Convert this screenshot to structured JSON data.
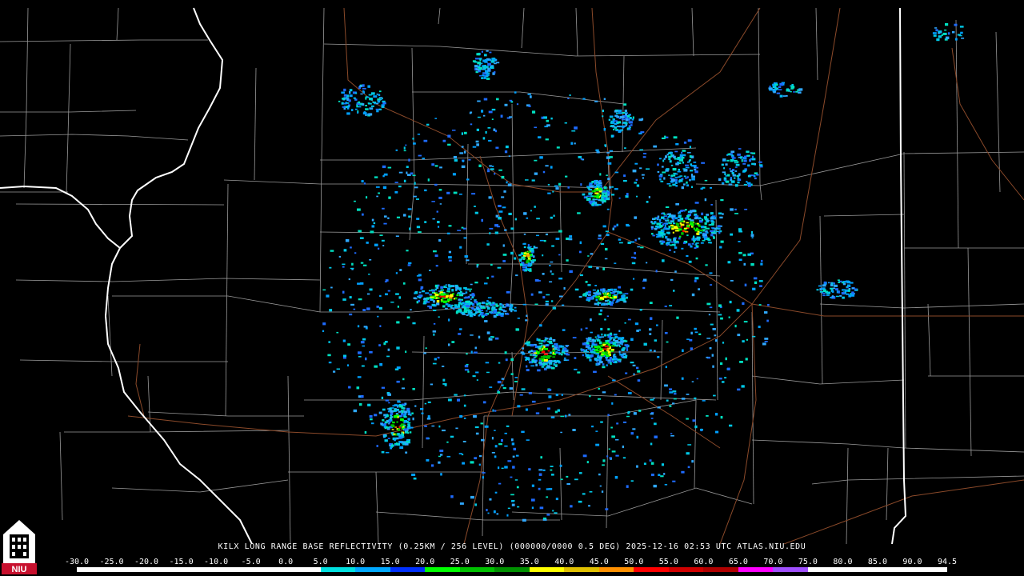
{
  "product": {
    "caption": "KILX LONG RANGE BASE REFLECTIVITY (0.25KM / 256 LEVEL) (000000/0000 0.5 DEG) 2025-12-16 02:53 UTC  ATLAS.NIU.EDU"
  },
  "logo": {
    "text": "NIU",
    "color": "#c8102e"
  },
  "colors": {
    "state_border": "#ffffff",
    "county_border": "#9a9a9a",
    "highway": "#8b4a2a",
    "background": "#000000"
  },
  "scale": {
    "labels": [
      "-30.0",
      "-25.0",
      "-20.0",
      "-15.0",
      "-10.0",
      "-5.0",
      "0.0",
      "5.0",
      "10.0",
      "15.0",
      "20.0",
      "25.0",
      "30.0",
      "35.0",
      "40.0",
      "45.0",
      "50.0",
      "55.0",
      "60.0",
      "65.0",
      "70.0",
      "75.0",
      "80.0",
      "85.0",
      "90.0",
      "94.5"
    ],
    "colors": [
      "#ffffff",
      "#ffffff",
      "#ffffff",
      "#ffffff",
      "#ffffff",
      "#ffffff",
      "#ffffff",
      "#00e0e0",
      "#00a8ff",
      "#0030ff",
      "#00ff00",
      "#00c000",
      "#009000",
      "#ffff00",
      "#e0c000",
      "#ff9000",
      "#ff0000",
      "#d00000",
      "#b00000",
      "#ff00ff",
      "#a050ff",
      "#ffffff",
      "#ffffff",
      "#ffffff",
      "#ffffff"
    ]
  }
}
